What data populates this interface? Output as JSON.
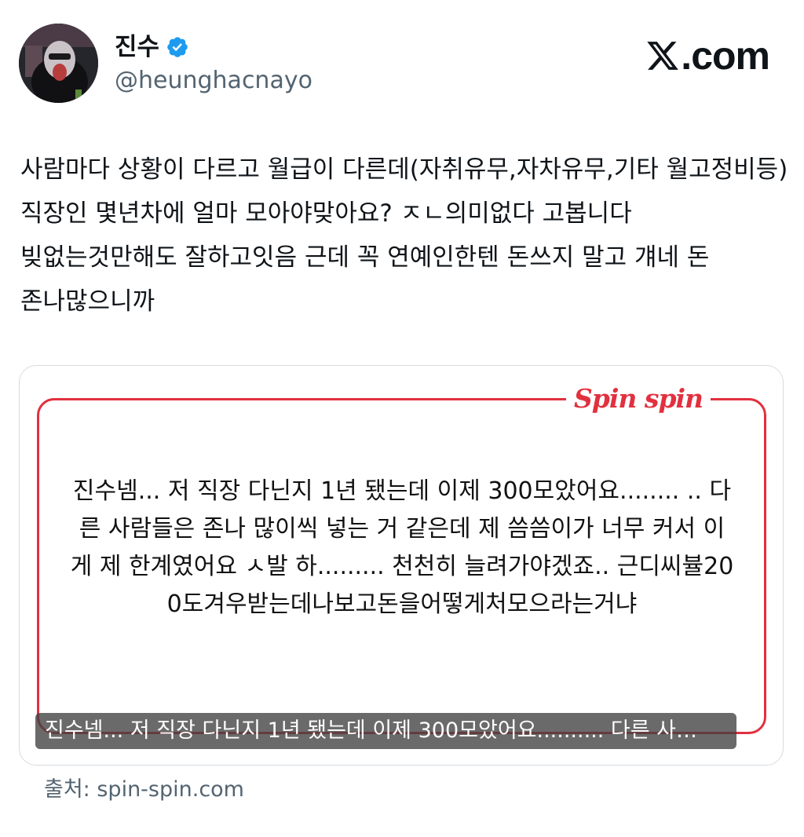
{
  "author": {
    "display_name": "진수",
    "handle": "@heunghacnayo"
  },
  "brand": {
    "domain": ".com"
  },
  "tweet": {
    "text": "사람마다 상황이 다르고 월급이 다른데(자취유무,자차유무,기타 월고정비등) 직장인 몇년차에 얼마 모아야맞아요? ㅈㄴ의미없다 고봅니다 빚없는것만해도 잘하고잇음 근데 꼭 연예인한텐 돈쓰지 말고 걔네 돈 존나많으니까"
  },
  "media": {
    "logo_text": "Spin spin",
    "quote_text": "진수넴... 저 직장 다닌지 1년 됐는데 이제 300모았어요........ .. 다른 사람들은 존나 많이씩 넣는 거 같은데 제 씀씀이가 너무 커서 이게 제 한계였어요 ㅅ발 하......... 천천히 늘려가야겠죠.. 근디씨뷸200도겨우받는데나보고돈을어떻게처모으라는거냐",
    "alt_caption": "진수넴... 저 직장 다닌지 1년 됐는데 이제 300모았어요.......... 다른 사…"
  },
  "source": {
    "text": "출처: spin-spin.com"
  }
}
